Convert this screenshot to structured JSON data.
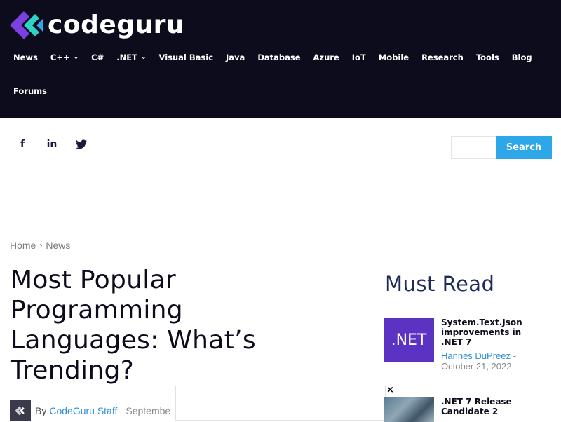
{
  "brand": {
    "name": "codeguru",
    "icon": "double-chevron-left-logo"
  },
  "nav": {
    "items": [
      {
        "label": "News",
        "dropdown": false
      },
      {
        "label": "C++",
        "dropdown": true
      },
      {
        "label": "C#",
        "dropdown": false
      },
      {
        "label": ".NET",
        "dropdown": true
      },
      {
        "label": "Visual Basic",
        "dropdown": false
      },
      {
        "label": "Java",
        "dropdown": false
      },
      {
        "label": "Database",
        "dropdown": false
      },
      {
        "label": "Azure",
        "dropdown": false
      },
      {
        "label": "IoT",
        "dropdown": false
      },
      {
        "label": "Mobile",
        "dropdown": false
      },
      {
        "label": "Research",
        "dropdown": false
      },
      {
        "label": "Tools",
        "dropdown": false
      },
      {
        "label": "Blog",
        "dropdown": false
      },
      {
        "label": "Forums",
        "dropdown": false
      }
    ]
  },
  "social": {
    "facebook": "f",
    "linkedin": "in",
    "twitter": "twitter-bird-icon"
  },
  "search": {
    "placeholder": "",
    "button_label": "Search"
  },
  "breadcrumb": {
    "home": "Home",
    "separator": "›",
    "current": "News"
  },
  "article": {
    "title": "Most Popular Programming Languages: What’s Trending?",
    "byline_prefix": "By",
    "author": "CodeGuru Staff",
    "date": "Septembe"
  },
  "ad": {
    "close_label": "×"
  },
  "sidebar": {
    "heading": "Must Read",
    "cards": [
      {
        "thumb_text": ".NET",
        "title": "System.Text.Json improvements in .NET 7",
        "author": "Hannes DuPreez",
        "date_sep": " - ",
        "date": "October 21, 2022"
      },
      {
        "thumb_text": "",
        "title": ".NET 7 Release Candidate 2"
      }
    ]
  },
  "colors": {
    "header_bg": "#0c0c1d",
    "accent": "#2ea7e8",
    "link": "#2e8fd8",
    "net_purple": "#5b32c2",
    "heading_navy": "#1c2a5a"
  }
}
